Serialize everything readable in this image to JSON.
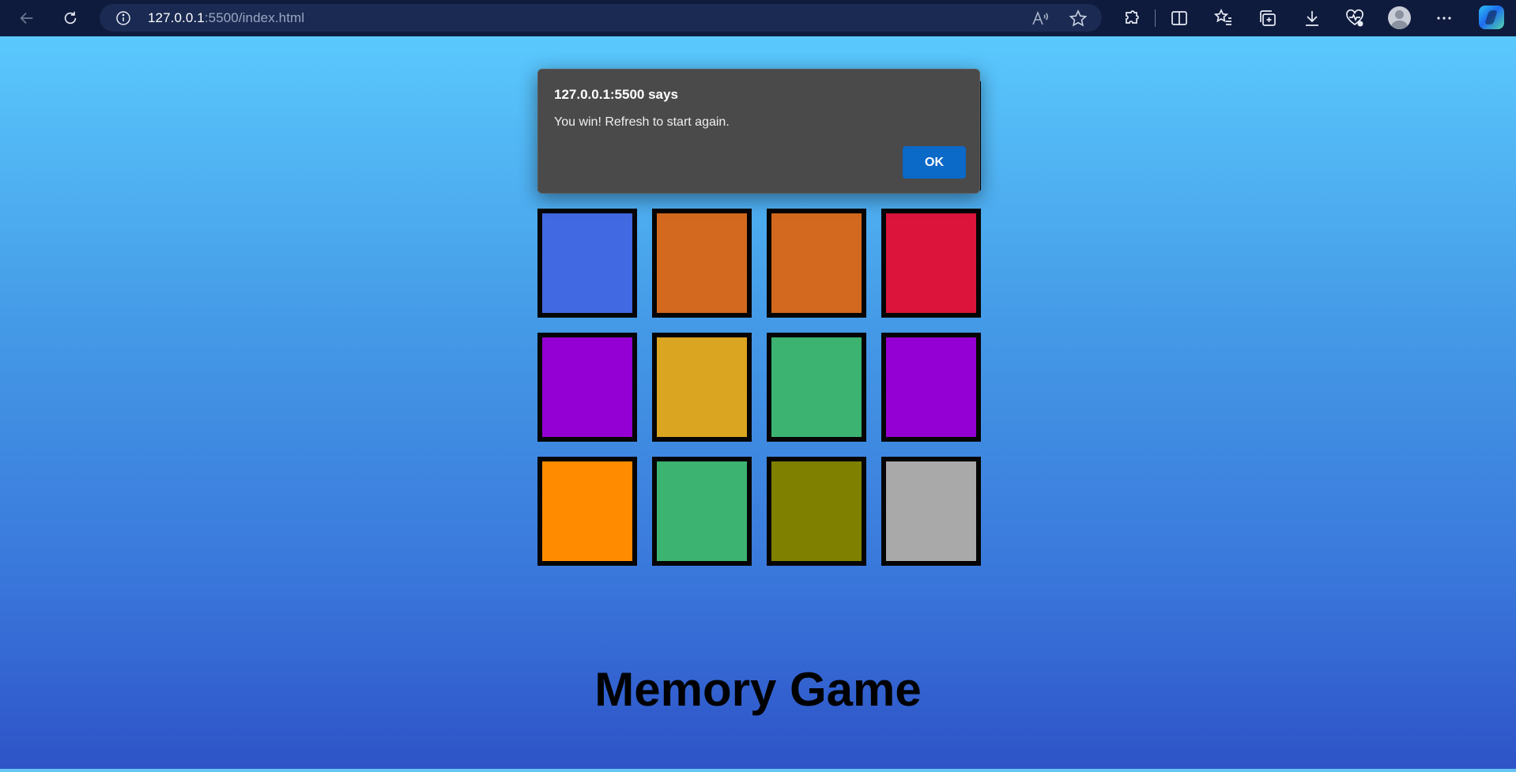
{
  "browser": {
    "url_host": "127.0.0.1",
    "url_rest": ":5500/index.html"
  },
  "dialog": {
    "title": "127.0.0.1:5500 says",
    "message": "You win! Refresh to start again.",
    "ok_label": "OK"
  },
  "page": {
    "title": "Memory Game"
  },
  "cards": [
    {
      "color": "#DAA520",
      "row": 0,
      "col": 0
    },
    {
      "color": "#DC143C",
      "row": 0,
      "col": 1
    },
    {
      "color": "#808000",
      "row": 0,
      "col": 2
    },
    {
      "color": "#4169E1",
      "row": 0,
      "col": 3
    },
    {
      "color": "#4169E1",
      "row": 1,
      "col": 0
    },
    {
      "color": "#D2691E",
      "row": 1,
      "col": 1
    },
    {
      "color": "#D2691E",
      "row": 1,
      "col": 2
    },
    {
      "color": "#DC143C",
      "row": 1,
      "col": 3
    },
    {
      "color": "#9400D3",
      "row": 2,
      "col": 0
    },
    {
      "color": "#DAA520",
      "row": 2,
      "col": 1
    },
    {
      "color": "#3CB371",
      "row": 2,
      "col": 2
    },
    {
      "color": "#9400D3",
      "row": 2,
      "col": 3
    },
    {
      "color": "#FF8C00",
      "row": 3,
      "col": 0
    },
    {
      "color": "#3CB371",
      "row": 3,
      "col": 1
    },
    {
      "color": "#808000",
      "row": 3,
      "col": 2
    },
    {
      "color": "#A9A9A9",
      "row": 3,
      "col": 3
    }
  ],
  "icons": [
    "back-icon",
    "refresh-icon",
    "info-icon",
    "read-aloud-icon",
    "favorite-star-icon",
    "extensions-icon",
    "split-screen-icon",
    "favorites-icon",
    "collections-icon",
    "downloads-icon",
    "browser-essentials-icon",
    "profile-avatar",
    "more-icon",
    "copilot-icon"
  ]
}
